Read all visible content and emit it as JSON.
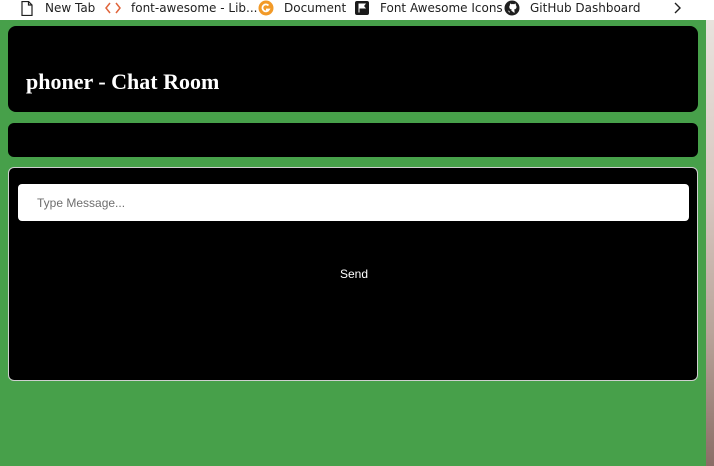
{
  "bookmarks": {
    "items": [
      {
        "label": "New Tab",
        "icon": "page-icon"
      },
      {
        "label": "font-awesome - Lib...",
        "icon": "code-icon"
      },
      {
        "label": "Document",
        "icon": "document-icon"
      },
      {
        "label": "Font Awesome Icons",
        "icon": "flag-icon"
      },
      {
        "label": "GitHub Dashboard",
        "icon": "github-icon"
      }
    ],
    "more_icon": "chevron-right-icon"
  },
  "app": {
    "title": "phoner - Chat Room",
    "background_color": "#47a04a",
    "panel_color": "#000000"
  },
  "composer": {
    "input_placeholder": "Type Message...",
    "input_value": "",
    "send_label": "Send"
  }
}
